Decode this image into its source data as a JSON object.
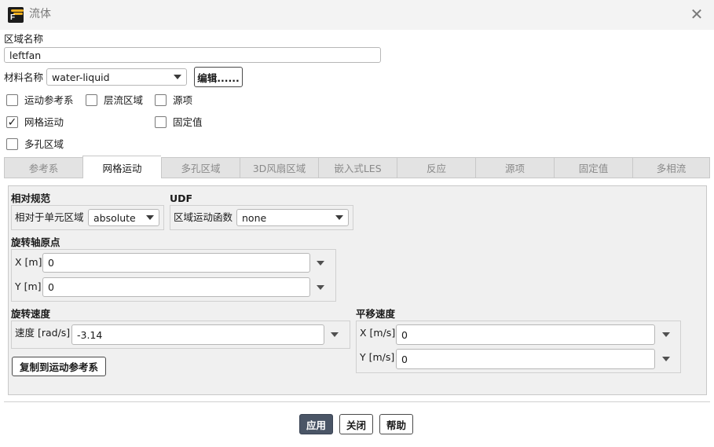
{
  "window": {
    "title": "流体"
  },
  "zone_name": {
    "label": "区域名称",
    "value": "leftfan"
  },
  "material": {
    "label": "材料名称",
    "value": "water-liquid",
    "edit_button": "编辑......"
  },
  "checkboxes": {
    "moving_ref": {
      "label": "运动参考系",
      "checked": false
    },
    "laminar": {
      "label": "层流区域",
      "checked": false
    },
    "source": {
      "label": "源项",
      "checked": false
    },
    "mesh_motion": {
      "label": "网格运动",
      "checked": true
    },
    "fixed": {
      "label": "固定值",
      "checked": false
    },
    "porous": {
      "label": "多孔区域",
      "checked": false
    }
  },
  "tabs": [
    "参考系",
    "网格运动",
    "多孔区域",
    "3D风扇区域",
    "嵌入式LES",
    "反应",
    "源项",
    "固定值",
    "多相流"
  ],
  "active_tab": "网格运动",
  "relative_spec": {
    "heading": "相对规范",
    "label": "相对于单元区域",
    "value": "absolute"
  },
  "udf": {
    "heading": "UDF",
    "label": "区域运动函数",
    "value": "none"
  },
  "rotation_origin": {
    "heading": "旋转轴原点",
    "x_label": "X [m]",
    "x_value": "0",
    "y_label": "Y [m]",
    "y_value": "0"
  },
  "rotation_velocity": {
    "heading": "旋转速度",
    "label": "速度 [rad/s]",
    "value": "-3.14",
    "copy_button": "复制到运动参考系"
  },
  "translation_velocity": {
    "heading": "平移速度",
    "x_label": "X [m/s]",
    "x_value": "0",
    "y_label": "Y [m/s]",
    "y_value": "0"
  },
  "footer": {
    "apply": "应用",
    "close": "关闭",
    "help": "帮助"
  }
}
